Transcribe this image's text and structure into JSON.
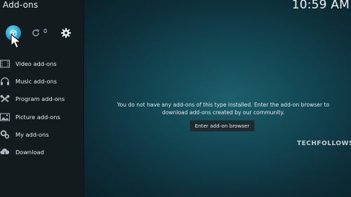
{
  "window": {
    "title": "Add-ons",
    "clock": "10:59 AM"
  },
  "toolbar": {
    "update_count": "0"
  },
  "sidebar": {
    "items": [
      {
        "label": "Video add-ons",
        "icon": "video-icon"
      },
      {
        "label": "Music add-ons",
        "icon": "headphones-icon"
      },
      {
        "label": "Program add-ons",
        "icon": "program-icon"
      },
      {
        "label": "Picture add-ons",
        "icon": "picture-icon"
      },
      {
        "label": "My add-ons",
        "icon": "gears-icon"
      },
      {
        "label": "Download",
        "icon": "cloud-download-icon"
      }
    ]
  },
  "main": {
    "message_line1": "You do not have any add-ons of this type installed. Enter the add-on browser to",
    "message_line2": "download add-ons created by our community.",
    "browser_button_label": "Enter add-on browser"
  },
  "watermark": "TECHFOLLOWS",
  "colors": {
    "accent": "#1f9fcf",
    "sidebar_bg": "#141b1f",
    "main_bg": "#124552"
  }
}
